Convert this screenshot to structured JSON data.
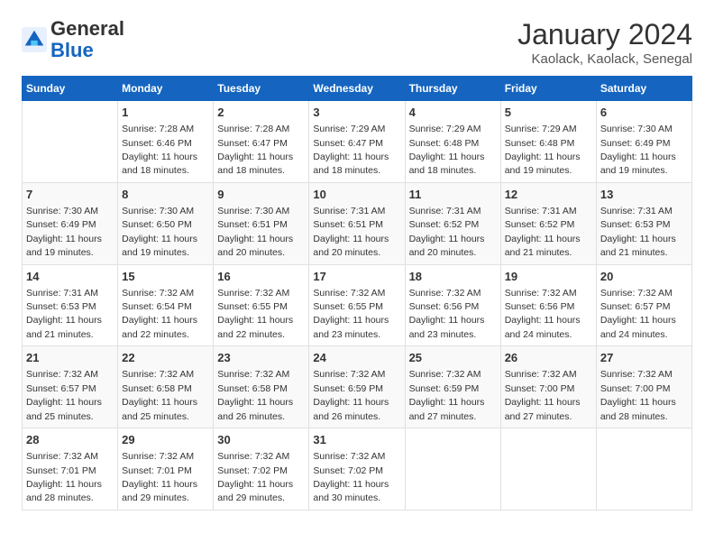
{
  "header": {
    "logo_line1": "General",
    "logo_line2": "Blue",
    "title": "January 2024",
    "subtitle": "Kaolack, Kaolack, Senegal"
  },
  "weekdays": [
    "Sunday",
    "Monday",
    "Tuesday",
    "Wednesday",
    "Thursday",
    "Friday",
    "Saturday"
  ],
  "weeks": [
    [
      {
        "day": "",
        "info": ""
      },
      {
        "day": "1",
        "info": "Sunrise: 7:28 AM\nSunset: 6:46 PM\nDaylight: 11 hours\nand 18 minutes."
      },
      {
        "day": "2",
        "info": "Sunrise: 7:28 AM\nSunset: 6:47 PM\nDaylight: 11 hours\nand 18 minutes."
      },
      {
        "day": "3",
        "info": "Sunrise: 7:29 AM\nSunset: 6:47 PM\nDaylight: 11 hours\nand 18 minutes."
      },
      {
        "day": "4",
        "info": "Sunrise: 7:29 AM\nSunset: 6:48 PM\nDaylight: 11 hours\nand 18 minutes."
      },
      {
        "day": "5",
        "info": "Sunrise: 7:29 AM\nSunset: 6:48 PM\nDaylight: 11 hours\nand 19 minutes."
      },
      {
        "day": "6",
        "info": "Sunrise: 7:30 AM\nSunset: 6:49 PM\nDaylight: 11 hours\nand 19 minutes."
      }
    ],
    [
      {
        "day": "7",
        "info": "Sunrise: 7:30 AM\nSunset: 6:49 PM\nDaylight: 11 hours\nand 19 minutes."
      },
      {
        "day": "8",
        "info": "Sunrise: 7:30 AM\nSunset: 6:50 PM\nDaylight: 11 hours\nand 19 minutes."
      },
      {
        "day": "9",
        "info": "Sunrise: 7:30 AM\nSunset: 6:51 PM\nDaylight: 11 hours\nand 20 minutes."
      },
      {
        "day": "10",
        "info": "Sunrise: 7:31 AM\nSunset: 6:51 PM\nDaylight: 11 hours\nand 20 minutes."
      },
      {
        "day": "11",
        "info": "Sunrise: 7:31 AM\nSunset: 6:52 PM\nDaylight: 11 hours\nand 20 minutes."
      },
      {
        "day": "12",
        "info": "Sunrise: 7:31 AM\nSunset: 6:52 PM\nDaylight: 11 hours\nand 21 minutes."
      },
      {
        "day": "13",
        "info": "Sunrise: 7:31 AM\nSunset: 6:53 PM\nDaylight: 11 hours\nand 21 minutes."
      }
    ],
    [
      {
        "day": "14",
        "info": "Sunrise: 7:31 AM\nSunset: 6:53 PM\nDaylight: 11 hours\nand 21 minutes."
      },
      {
        "day": "15",
        "info": "Sunrise: 7:32 AM\nSunset: 6:54 PM\nDaylight: 11 hours\nand 22 minutes."
      },
      {
        "day": "16",
        "info": "Sunrise: 7:32 AM\nSunset: 6:55 PM\nDaylight: 11 hours\nand 22 minutes."
      },
      {
        "day": "17",
        "info": "Sunrise: 7:32 AM\nSunset: 6:55 PM\nDaylight: 11 hours\nand 23 minutes."
      },
      {
        "day": "18",
        "info": "Sunrise: 7:32 AM\nSunset: 6:56 PM\nDaylight: 11 hours\nand 23 minutes."
      },
      {
        "day": "19",
        "info": "Sunrise: 7:32 AM\nSunset: 6:56 PM\nDaylight: 11 hours\nand 24 minutes."
      },
      {
        "day": "20",
        "info": "Sunrise: 7:32 AM\nSunset: 6:57 PM\nDaylight: 11 hours\nand 24 minutes."
      }
    ],
    [
      {
        "day": "21",
        "info": "Sunrise: 7:32 AM\nSunset: 6:57 PM\nDaylight: 11 hours\nand 25 minutes."
      },
      {
        "day": "22",
        "info": "Sunrise: 7:32 AM\nSunset: 6:58 PM\nDaylight: 11 hours\nand 25 minutes."
      },
      {
        "day": "23",
        "info": "Sunrise: 7:32 AM\nSunset: 6:58 PM\nDaylight: 11 hours\nand 26 minutes."
      },
      {
        "day": "24",
        "info": "Sunrise: 7:32 AM\nSunset: 6:59 PM\nDaylight: 11 hours\nand 26 minutes."
      },
      {
        "day": "25",
        "info": "Sunrise: 7:32 AM\nSunset: 6:59 PM\nDaylight: 11 hours\nand 27 minutes."
      },
      {
        "day": "26",
        "info": "Sunrise: 7:32 AM\nSunset: 7:00 PM\nDaylight: 11 hours\nand 27 minutes."
      },
      {
        "day": "27",
        "info": "Sunrise: 7:32 AM\nSunset: 7:00 PM\nDaylight: 11 hours\nand 28 minutes."
      }
    ],
    [
      {
        "day": "28",
        "info": "Sunrise: 7:32 AM\nSunset: 7:01 PM\nDaylight: 11 hours\nand 28 minutes."
      },
      {
        "day": "29",
        "info": "Sunrise: 7:32 AM\nSunset: 7:01 PM\nDaylight: 11 hours\nand 29 minutes."
      },
      {
        "day": "30",
        "info": "Sunrise: 7:32 AM\nSunset: 7:02 PM\nDaylight: 11 hours\nand 29 minutes."
      },
      {
        "day": "31",
        "info": "Sunrise: 7:32 AM\nSunset: 7:02 PM\nDaylight: 11 hours\nand 30 minutes."
      },
      {
        "day": "",
        "info": ""
      },
      {
        "day": "",
        "info": ""
      },
      {
        "day": "",
        "info": ""
      }
    ]
  ]
}
